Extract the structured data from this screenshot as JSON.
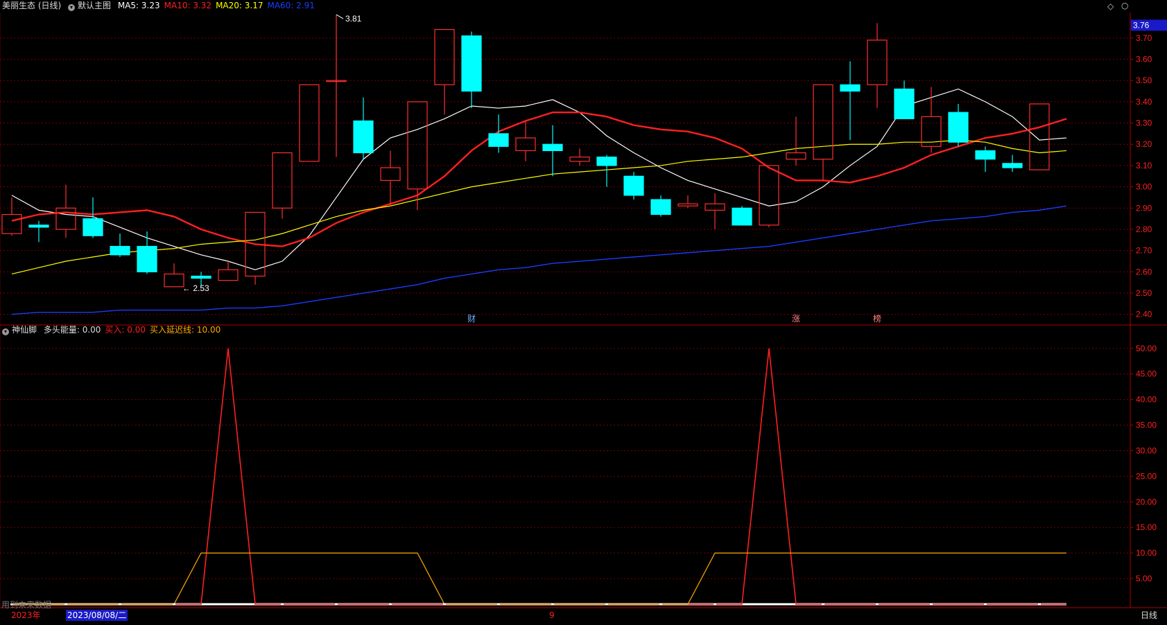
{
  "header": {
    "stock_title": "美丽生态 (日线)",
    "main_chart_label": "默认主图",
    "ma": [
      {
        "label": "MA5: ",
        "value": "3.23",
        "color": "#ffffff"
      },
      {
        "label": "MA10: ",
        "value": "3.32",
        "color": "#ff2020"
      },
      {
        "label": "MA20: ",
        "value": "3.17",
        "color": "#ffff00"
      },
      {
        "label": "MA60: ",
        "value": "2.91",
        "color": "#1a3cff"
      }
    ]
  },
  "indicator_header": {
    "name": "神仙脚",
    "items": [
      {
        "label": "多头能量: ",
        "value": "0.00",
        "color": "#dddddd"
      },
      {
        "label": "买入: ",
        "value": "0.00",
        "color": "#ff2020"
      },
      {
        "label": "买入延迟线: ",
        "value": "10.00",
        "color": "#ffaa00"
      }
    ]
  },
  "price_axis": {
    "ticks": [
      "3.70",
      "3.60",
      "3.50",
      "3.40",
      "3.30",
      "3.20",
      "3.10",
      "3.00",
      "2.90",
      "2.80",
      "2.70",
      "2.60",
      "2.50",
      "2.40"
    ],
    "current_price": "3.76"
  },
  "indicator_axis": {
    "ticks": [
      "50.00",
      "45.00",
      "40.00",
      "35.00",
      "30.00",
      "25.00",
      "20.00",
      "15.00",
      "10.00",
      "5.00"
    ]
  },
  "annotations": {
    "high_label": "3.81",
    "low_label": "2.53",
    "event_markers": [
      {
        "text": "财",
        "index": 17
      },
      {
        "text": "涨",
        "index": 29
      },
      {
        "text": "榜",
        "index": 32
      }
    ]
  },
  "footer": {
    "future_data_note": "用到未来数据",
    "year_label": "2023年",
    "date_cursor": "2023/08/08/二",
    "month_marker": "9",
    "period_label": "日线"
  },
  "colors": {
    "up": "#ff3030",
    "down": "#00ffff",
    "ma5": "#ffffff",
    "ma10": "#ff2020",
    "ma20": "#ffff00",
    "ma60": "#1a3cff",
    "grid": "#7a0000",
    "delay": "#ffaa00"
  },
  "chart_data": [
    {
      "type": "candlestick",
      "ylim": [
        2.36,
        3.82
      ],
      "candles": [
        {
          "o": 2.78,
          "h": 2.95,
          "l": 2.77,
          "c": 2.87
        },
        {
          "o": 2.82,
          "h": 2.84,
          "l": 2.74,
          "c": 2.81
        },
        {
          "o": 2.8,
          "h": 3.01,
          "l": 2.76,
          "c": 2.9
        },
        {
          "o": 2.85,
          "h": 2.95,
          "l": 2.76,
          "c": 2.77
        },
        {
          "o": 2.72,
          "h": 2.78,
          "l": 2.67,
          "c": 2.68
        },
        {
          "o": 2.72,
          "h": 2.79,
          "l": 2.59,
          "c": 2.6
        },
        {
          "o": 2.53,
          "h": 2.64,
          "l": 2.53,
          "c": 2.59
        },
        {
          "o": 2.58,
          "h": 2.6,
          "l": 2.53,
          "c": 2.57
        },
        {
          "o": 2.56,
          "h": 2.65,
          "l": 2.56,
          "c": 2.61
        },
        {
          "o": 2.58,
          "h": 2.88,
          "l": 2.54,
          "c": 2.88
        },
        {
          "o": 2.9,
          "h": 3.16,
          "l": 2.85,
          "c": 3.16
        },
        {
          "o": 3.12,
          "h": 3.48,
          "l": 3.12,
          "c": 3.48
        },
        {
          "o": 3.5,
          "h": 3.81,
          "l": 3.14,
          "c": 3.5
        },
        {
          "o": 3.31,
          "h": 3.42,
          "l": 3.13,
          "c": 3.16
        },
        {
          "o": 3.03,
          "h": 3.17,
          "l": 2.91,
          "c": 3.09
        },
        {
          "o": 2.99,
          "h": 3.4,
          "l": 2.89,
          "c": 3.4
        },
        {
          "o": 3.48,
          "h": 3.74,
          "l": 3.34,
          "c": 3.74
        },
        {
          "o": 3.71,
          "h": 3.73,
          "l": 3.37,
          "c": 3.45
        },
        {
          "o": 3.25,
          "h": 3.34,
          "l": 3.16,
          "c": 3.19
        },
        {
          "o": 3.17,
          "h": 3.31,
          "l": 3.12,
          "c": 3.23
        },
        {
          "o": 3.2,
          "h": 3.29,
          "l": 3.05,
          "c": 3.17
        },
        {
          "o": 3.12,
          "h": 3.18,
          "l": 3.1,
          "c": 3.14
        },
        {
          "o": 3.14,
          "h": 3.15,
          "l": 3.0,
          "c": 3.1
        },
        {
          "o": 3.05,
          "h": 3.07,
          "l": 2.94,
          "c": 2.96
        },
        {
          "o": 2.94,
          "h": 2.96,
          "l": 2.86,
          "c": 2.87
        },
        {
          "o": 2.91,
          "h": 2.96,
          "l": 2.9,
          "c": 2.92
        },
        {
          "o": 2.89,
          "h": 2.97,
          "l": 2.8,
          "c": 2.92
        },
        {
          "o": 2.9,
          "h": 2.91,
          "l": 2.82,
          "c": 2.82
        },
        {
          "o": 2.82,
          "h": 3.1,
          "l": 2.81,
          "c": 3.1
        },
        {
          "o": 3.13,
          "h": 3.33,
          "l": 3.1,
          "c": 3.16
        },
        {
          "o": 3.13,
          "h": 3.48,
          "l": 3.03,
          "c": 3.48
        },
        {
          "o": 3.48,
          "h": 3.59,
          "l": 3.22,
          "c": 3.45
        },
        {
          "o": 3.48,
          "h": 3.77,
          "l": 3.37,
          "c": 3.69
        },
        {
          "o": 3.46,
          "h": 3.5,
          "l": 3.32,
          "c": 3.32
        },
        {
          "o": 3.19,
          "h": 3.47,
          "l": 3.16,
          "c": 3.33
        },
        {
          "o": 3.35,
          "h": 3.39,
          "l": 3.19,
          "c": 3.21
        },
        {
          "o": 3.17,
          "h": 3.19,
          "l": 3.07,
          "c": 3.13
        },
        {
          "o": 3.11,
          "h": 3.15,
          "l": 3.07,
          "c": 3.09
        },
        {
          "o": 3.08,
          "h": 3.39,
          "l": 3.08,
          "c": 3.39
        }
      ],
      "series": [
        {
          "name": "MA5",
          "values": [
            2.96,
            2.89,
            2.87,
            2.86,
            2.81,
            2.76,
            2.72,
            2.68,
            2.65,
            2.61,
            2.65,
            2.77,
            2.95,
            3.13,
            3.23,
            3.27,
            3.32,
            3.38,
            3.37,
            3.38,
            3.41,
            3.35,
            3.24,
            3.16,
            3.09,
            3.03,
            2.99,
            2.95,
            2.91,
            2.93,
            3.0,
            3.1,
            3.19,
            3.38,
            3.42,
            3.46,
            3.4,
            3.33,
            3.22,
            3.23
          ]
        },
        {
          "name": "MA10",
          "values": [
            2.84,
            2.87,
            2.88,
            2.87,
            2.88,
            2.89,
            2.86,
            2.8,
            2.76,
            2.73,
            2.72,
            2.76,
            2.83,
            2.88,
            2.92,
            2.96,
            3.05,
            3.17,
            3.26,
            3.31,
            3.35,
            3.35,
            3.33,
            3.29,
            3.27,
            3.26,
            3.23,
            3.18,
            3.09,
            3.03,
            3.03,
            3.02,
            3.05,
            3.09,
            3.15,
            3.19,
            3.23,
            3.25,
            3.28,
            3.32
          ]
        },
        {
          "name": "MA20",
          "values": [
            2.59,
            2.62,
            2.65,
            2.67,
            2.69,
            2.7,
            2.71,
            2.73,
            2.74,
            2.75,
            2.78,
            2.82,
            2.86,
            2.89,
            2.91,
            2.94,
            2.97,
            3.0,
            3.02,
            3.04,
            3.06,
            3.07,
            3.08,
            3.09,
            3.1,
            3.12,
            3.13,
            3.14,
            3.16,
            3.18,
            3.19,
            3.2,
            3.2,
            3.21,
            3.21,
            3.22,
            3.21,
            3.18,
            3.16,
            3.17
          ]
        },
        {
          "name": "MA60",
          "values": [
            2.4,
            2.41,
            2.41,
            2.41,
            2.42,
            2.42,
            2.42,
            2.42,
            2.43,
            2.43,
            2.44,
            2.46,
            2.48,
            2.5,
            2.52,
            2.54,
            2.57,
            2.59,
            2.61,
            2.62,
            2.64,
            2.65,
            2.66,
            2.67,
            2.68,
            2.69,
            2.7,
            2.71,
            2.72,
            2.74,
            2.76,
            2.78,
            2.8,
            2.82,
            2.84,
            2.85,
            2.86,
            2.88,
            2.89,
            2.91
          ]
        }
      ]
    },
    {
      "type": "line",
      "ylim": [
        0,
        52
      ],
      "series": [
        {
          "name": "多头能量",
          "values": [
            0,
            0,
            0,
            0,
            0,
            0,
            0,
            0,
            0,
            0,
            0,
            0,
            0,
            0,
            0,
            0,
            0,
            0,
            0,
            0,
            0,
            0,
            0,
            0,
            0,
            0,
            0,
            0,
            0,
            0,
            0,
            0,
            0,
            0,
            0,
            0,
            0,
            0,
            0,
            0
          ]
        },
        {
          "name": "买入",
          "values": [
            0,
            0,
            0,
            0,
            0,
            0,
            0,
            0,
            50,
            0,
            0,
            0,
            0,
            0,
            0,
            0,
            0,
            0,
            0,
            0,
            0,
            0,
            0,
            0,
            0,
            0,
            0,
            0,
            50,
            0,
            0,
            0,
            0,
            0,
            0,
            0,
            0,
            0,
            0,
            0
          ]
        },
        {
          "name": "买入延迟线",
          "values": [
            0,
            0,
            0,
            0,
            0,
            0,
            0,
            10,
            10,
            10,
            10,
            10,
            10,
            10,
            10,
            10,
            0,
            0,
            0,
            0,
            0,
            0,
            0,
            0,
            0,
            0,
            10,
            10,
            10,
            10,
            10,
            10,
            10,
            10,
            10,
            10,
            10,
            10,
            10,
            10
          ]
        }
      ]
    }
  ]
}
